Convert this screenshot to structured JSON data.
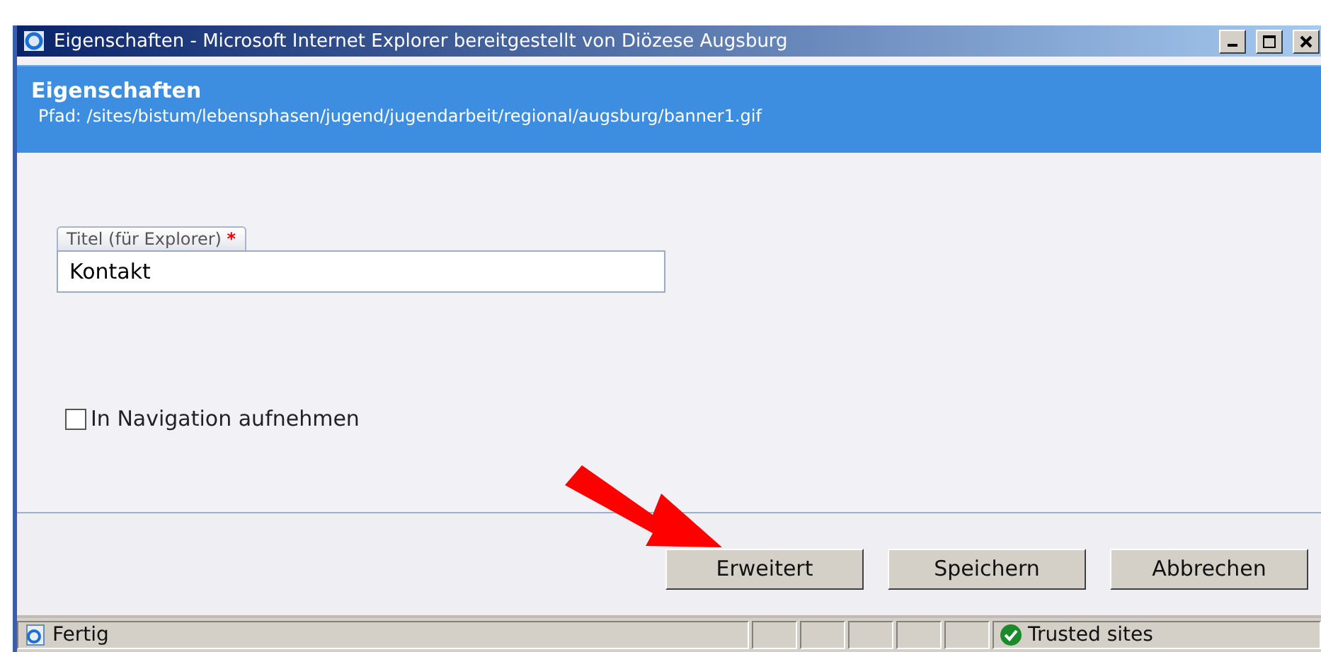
{
  "window": {
    "title": "Eigenschaften - Microsoft Internet Explorer bereitgestellt von Diözese Augsburg"
  },
  "header": {
    "title": "Eigenschaften",
    "path": "Pfad: /sites/bistum/lebensphasen/jugend/jugendarbeit/regional/augsburg/banner1.gif"
  },
  "title_field": {
    "label": "Titel (für Explorer)",
    "required_mark": "*",
    "value": "Kontakt"
  },
  "navigation_checkbox": {
    "label": "In Navigation aufnehmen",
    "checked": false
  },
  "buttons": [
    "Erweitert",
    "Speichern",
    "Abbrechen"
  ],
  "status_bar": {
    "text": "Fertig",
    "zone": "Trusted sites"
  }
}
